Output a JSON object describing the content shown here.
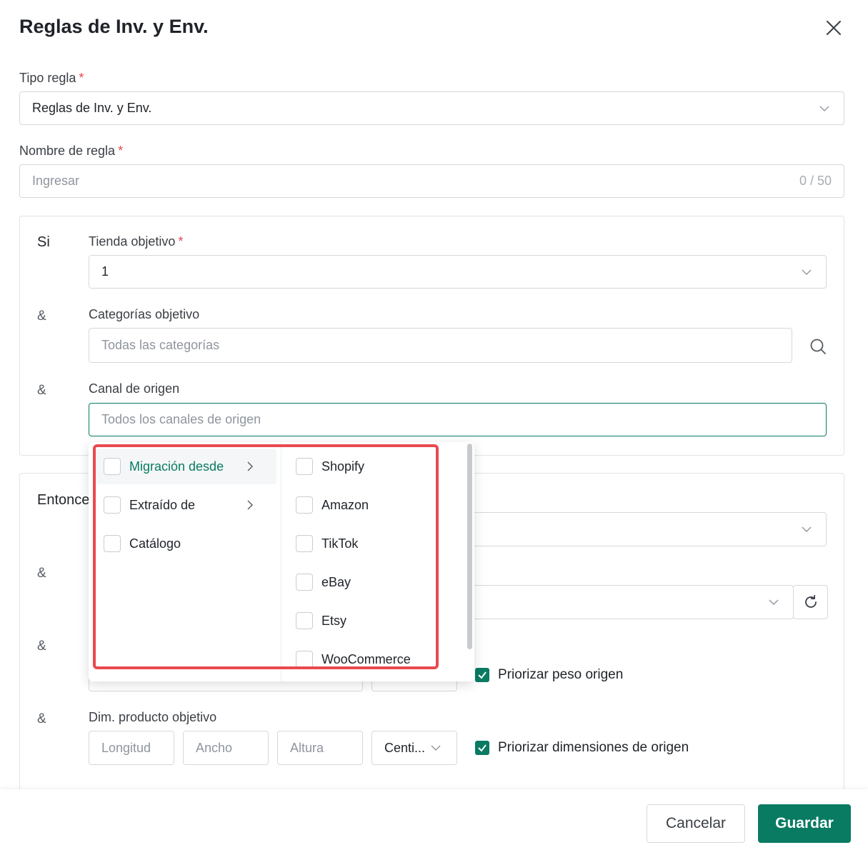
{
  "dialog": {
    "title": "Reglas de Inv. y Env."
  },
  "rule_type": {
    "label": "Tipo regla",
    "required_mark": "*",
    "value": "Reglas de Inv. y Env."
  },
  "rule_name": {
    "label": "Nombre de regla",
    "required_mark": "*",
    "placeholder": "Ingresar",
    "counter": "0 / 50"
  },
  "if_section": {
    "title": "Si",
    "conjunction": "&",
    "target_store": {
      "label": "Tienda objetivo",
      "required_mark": "*",
      "value": "1"
    },
    "target_categories": {
      "label": "Categorías objetivo",
      "placeholder": "Todas las categorías"
    },
    "source_channel": {
      "label": "Canal de origen",
      "placeholder": "Todos los canales de origen"
    }
  },
  "then_section": {
    "title": "Entonces",
    "conjunction": "&",
    "priority_weight_label": "Priorizar peso origen",
    "dims": {
      "label": "Dim. producto objetivo",
      "length_placeholder": "Longitud",
      "width_placeholder": "Ancho",
      "height_placeholder": "Altura",
      "unit_value": "Centi...",
      "priority_label": "Priorizar dimensiones de origen"
    }
  },
  "dropdown": {
    "groups": [
      {
        "label": "Migración desde",
        "has_submenu": true,
        "active": true
      },
      {
        "label": "Extraído de",
        "has_submenu": true,
        "active": false
      },
      {
        "label": "Catálogo",
        "has_submenu": false,
        "active": false
      }
    ],
    "options": [
      "Shopify",
      "Amazon",
      "TikTok",
      "eBay",
      "Etsy",
      "WooCommerce"
    ]
  },
  "footer": {
    "cancel_label": "Cancelar",
    "save_label": "Guardar"
  },
  "colors": {
    "accent": "#0a7b63",
    "required": "#e5484d",
    "highlight": "#e84a4f"
  }
}
